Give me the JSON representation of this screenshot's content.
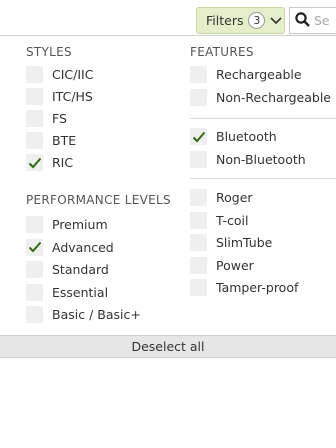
{
  "toolbar": {
    "filters_label": "Filters",
    "filters_count": "3",
    "search_placeholder": "Se"
  },
  "styles": {
    "heading": "STYLES",
    "items": [
      {
        "label": "CIC/IIC",
        "checked": false
      },
      {
        "label": "ITC/HS",
        "checked": false
      },
      {
        "label": "FS",
        "checked": false
      },
      {
        "label": "BTE",
        "checked": false
      },
      {
        "label": "RIC",
        "checked": true
      }
    ]
  },
  "performance": {
    "heading": "PERFORMANCE LEVELS",
    "items": [
      {
        "label": "Premium",
        "checked": false
      },
      {
        "label": "Advanced",
        "checked": true
      },
      {
        "label": "Standard",
        "checked": false
      },
      {
        "label": "Essential",
        "checked": false
      },
      {
        "label": "Basic / Basic+",
        "checked": false
      }
    ]
  },
  "features": {
    "heading": "FEATURES",
    "group1": [
      {
        "label": "Rechargeable",
        "checked": false
      },
      {
        "label": "Non-Rechargeable",
        "checked": false
      }
    ],
    "group2": [
      {
        "label": "Bluetooth",
        "checked": true
      },
      {
        "label": "Non-Bluetooth",
        "checked": false
      }
    ],
    "group3": [
      {
        "label": "Roger",
        "checked": false
      },
      {
        "label": "T-coil",
        "checked": false
      },
      {
        "label": "SlimTube",
        "checked": false
      },
      {
        "label": "Power",
        "checked": false
      },
      {
        "label": "Tamper-proof",
        "checked": false
      }
    ]
  },
  "deselect_label": "Deselect all",
  "colors": {
    "accent_filter_bg": "#e3efc9",
    "check_color": "#2f6b12",
    "checkbox_bg": "#efefef"
  }
}
